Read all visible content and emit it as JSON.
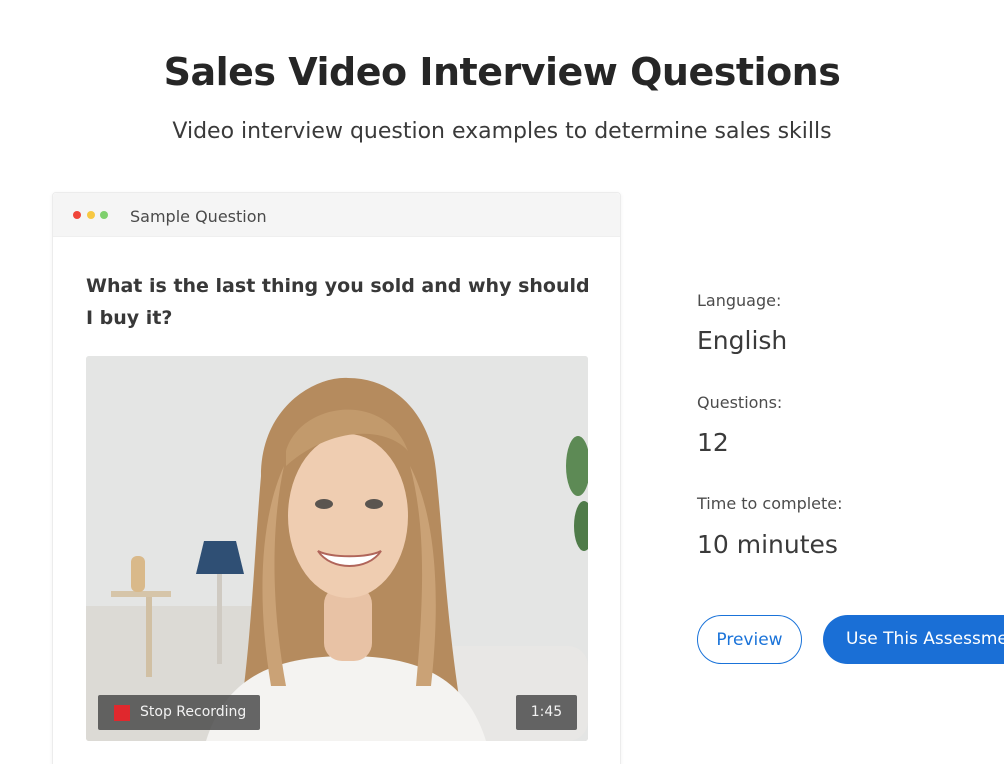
{
  "header": {
    "title": "Sales Video Interview Questions",
    "subtitle": "Video interview question examples to determine sales skills"
  },
  "card": {
    "header_label": "Sample Question",
    "question": "What is the last thing you sold and why should I buy it?",
    "video": {
      "record_button_label": "Stop Recording",
      "timer": "1:45"
    }
  },
  "details": {
    "language_label": "Language:",
    "language_value": "English",
    "questions_label": "Questions:",
    "questions_value": "12",
    "time_label": "Time to complete:",
    "time_value": "10 minutes"
  },
  "actions": {
    "preview_label": "Preview",
    "use_label": "Use This Assessment"
  },
  "colors": {
    "accent": "#1a6fd6",
    "record": "#e0282d",
    "dot_red": "#f0453a",
    "dot_yellow": "#f7c843",
    "dot_green": "#7fd06e"
  },
  "icons": {
    "window_controls": [
      "red-dot-icon",
      "yellow-dot-icon",
      "green-dot-icon"
    ],
    "record": "record-stop-icon"
  }
}
